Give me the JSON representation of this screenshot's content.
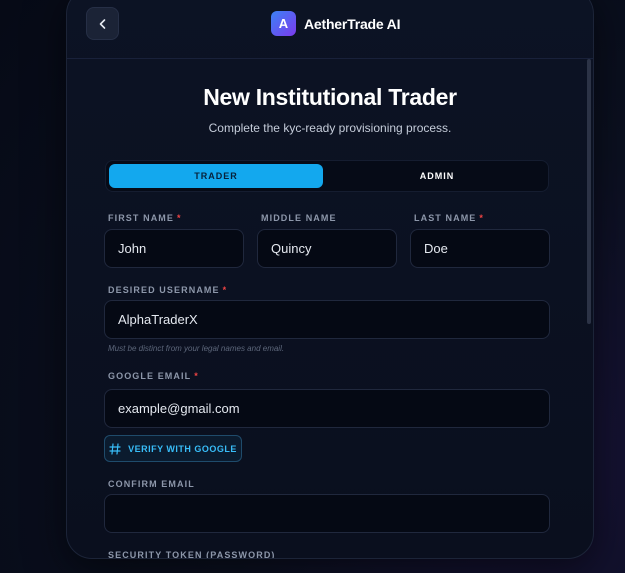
{
  "header": {
    "brand_logo_letter": "A",
    "brand_name": "AetherTrade AI"
  },
  "form": {
    "title": "New Institutional Trader",
    "subtitle": "Complete the kyc-ready provisioning process.",
    "role_tabs": [
      {
        "label": "TRADER",
        "active": true
      },
      {
        "label": "ADMIN",
        "active": false
      }
    ],
    "fields": {
      "first_name": {
        "label": "FIRST NAME",
        "required_mark": "*",
        "value": "John"
      },
      "middle_name": {
        "label": "MIDDLE NAME",
        "value": "Quincy"
      },
      "last_name": {
        "label": "LAST NAME",
        "required_mark": "*",
        "value": "Doe"
      },
      "username": {
        "label": "DESIRED USERNAME",
        "required_mark": "*",
        "value": "AlphaTraderX",
        "hint": "Must be distinct from your legal names and email."
      },
      "google_email": {
        "label": "GOOGLE EMAIL",
        "required_mark": "*",
        "placeholder": "example@gmail.com"
      },
      "confirm_email": {
        "label": "CONFIRM EMAIL",
        "placeholder": ""
      },
      "security_token": {
        "label": "SECURITY TOKEN (PASSWORD)"
      }
    },
    "verify_button_label": "VERIFY WITH GOOGLE"
  },
  "colors": {
    "accent": "#13a8ee",
    "required": "#ef4444",
    "verify_text": "#38bdf8"
  }
}
